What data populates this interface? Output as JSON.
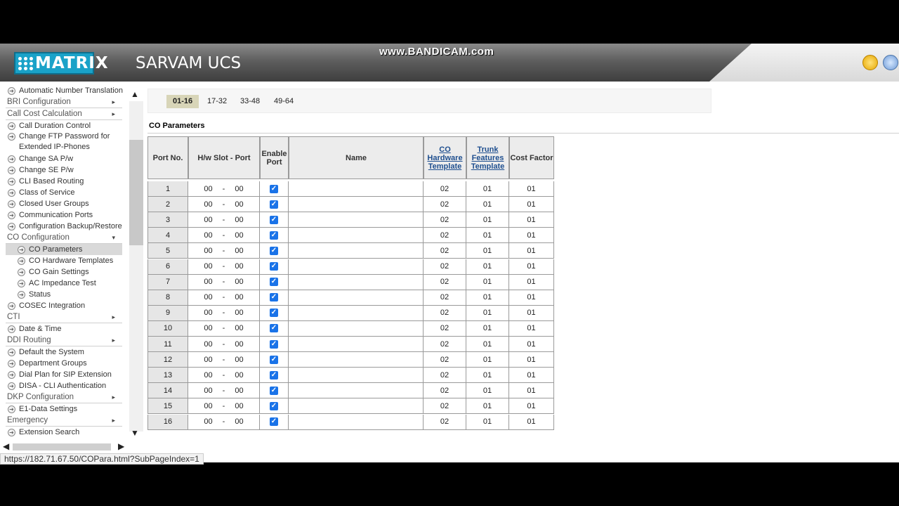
{
  "header": {
    "brand": "MATRIX",
    "app_title": "SARVAM UCS",
    "watermark": "www.BANDICAM.com",
    "icons": [
      "favorites-icon",
      "lock-icon"
    ]
  },
  "sidebar": {
    "items": [
      {
        "label": "Automatic Number Translation",
        "kind": "item"
      },
      {
        "label": "BRI Configuration",
        "kind": "cat",
        "caret": "▸"
      },
      {
        "label": "Call Cost Calculation",
        "kind": "cat",
        "caret": "▸"
      },
      {
        "label": "Call Duration Control",
        "kind": "item"
      },
      {
        "label": "Change FTP Password for Extended IP-Phones",
        "kind": "tall"
      },
      {
        "label": "Change SA P/w",
        "kind": "item"
      },
      {
        "label": "Change SE P/w",
        "kind": "item"
      },
      {
        "label": "CLI Based Routing",
        "kind": "item"
      },
      {
        "label": "Class of Service",
        "kind": "item"
      },
      {
        "label": "Closed User Groups",
        "kind": "item"
      },
      {
        "label": "Communication Ports",
        "kind": "item"
      },
      {
        "label": "Configuration Backup/Restore",
        "kind": "item"
      },
      {
        "label": "CO Configuration",
        "kind": "cat",
        "caret": "▾"
      },
      {
        "label": "CO Parameters",
        "kind": "sub",
        "active": true
      },
      {
        "label": "CO Hardware Templates",
        "kind": "sub"
      },
      {
        "label": "CO Gain Settings",
        "kind": "sub"
      },
      {
        "label": "AC Impedance Test",
        "kind": "sub"
      },
      {
        "label": "Status",
        "kind": "sub"
      },
      {
        "label": "COSEC Integration",
        "kind": "item"
      },
      {
        "label": "CTI",
        "kind": "cat",
        "caret": "▸"
      },
      {
        "label": "Date & Time",
        "kind": "item"
      },
      {
        "label": "DDI Routing",
        "kind": "cat",
        "caret": "▸"
      },
      {
        "label": "Default the System",
        "kind": "item"
      },
      {
        "label": "Department Groups",
        "kind": "item"
      },
      {
        "label": "Dial Plan for SIP Extension",
        "kind": "item"
      },
      {
        "label": "DISA - CLI Authentication",
        "kind": "item"
      },
      {
        "label": "DKP Configuration",
        "kind": "cat",
        "caret": "▸"
      },
      {
        "label": "E1-Data Settings",
        "kind": "item"
      },
      {
        "label": "Emergency",
        "kind": "cat",
        "caret": "▸"
      },
      {
        "label": "Extension Search",
        "kind": "item"
      }
    ]
  },
  "status_url": "https://182.71.67.50/COPara.html?SubPageIndex=1",
  "tabs": [
    {
      "label": "01-16",
      "active": true
    },
    {
      "label": "17-32"
    },
    {
      "label": "33-48"
    },
    {
      "label": "49-64"
    }
  ],
  "section_title": "CO Parameters",
  "table": {
    "headers": [
      "Port No.",
      "H/w Slot - Port",
      "Enable Port",
      "Name",
      "CO Hardware Template",
      "Trunk Features Template",
      "Cost Factor"
    ],
    "rows": [
      {
        "port": "1",
        "slot": "00",
        "slot_port": "00",
        "enabled": true,
        "name": "",
        "co_hw": "02",
        "trunk": "01",
        "cost": "01"
      },
      {
        "port": "2",
        "slot": "00",
        "slot_port": "00",
        "enabled": true,
        "name": "",
        "co_hw": "02",
        "trunk": "01",
        "cost": "01"
      },
      {
        "port": "3",
        "slot": "00",
        "slot_port": "00",
        "enabled": true,
        "name": "",
        "co_hw": "02",
        "trunk": "01",
        "cost": "01"
      },
      {
        "port": "4",
        "slot": "00",
        "slot_port": "00",
        "enabled": true,
        "name": "",
        "co_hw": "02",
        "trunk": "01",
        "cost": "01"
      },
      {
        "port": "5",
        "slot": "00",
        "slot_port": "00",
        "enabled": true,
        "name": "",
        "co_hw": "02",
        "trunk": "01",
        "cost": "01"
      },
      {
        "port": "6",
        "slot": "00",
        "slot_port": "00",
        "enabled": true,
        "name": "",
        "co_hw": "02",
        "trunk": "01",
        "cost": "01"
      },
      {
        "port": "7",
        "slot": "00",
        "slot_port": "00",
        "enabled": true,
        "name": "",
        "co_hw": "02",
        "trunk": "01",
        "cost": "01"
      },
      {
        "port": "8",
        "slot": "00",
        "slot_port": "00",
        "enabled": true,
        "name": "",
        "co_hw": "02",
        "trunk": "01",
        "cost": "01"
      },
      {
        "port": "9",
        "slot": "00",
        "slot_port": "00",
        "enabled": true,
        "name": "",
        "co_hw": "02",
        "trunk": "01",
        "cost": "01"
      },
      {
        "port": "10",
        "slot": "00",
        "slot_port": "00",
        "enabled": true,
        "name": "",
        "co_hw": "02",
        "trunk": "01",
        "cost": "01"
      },
      {
        "port": "11",
        "slot": "00",
        "slot_port": "00",
        "enabled": true,
        "name": "",
        "co_hw": "02",
        "trunk": "01",
        "cost": "01"
      },
      {
        "port": "12",
        "slot": "00",
        "slot_port": "00",
        "enabled": true,
        "name": "",
        "co_hw": "02",
        "trunk": "01",
        "cost": "01"
      },
      {
        "port": "13",
        "slot": "00",
        "slot_port": "00",
        "enabled": true,
        "name": "",
        "co_hw": "02",
        "trunk": "01",
        "cost": "01"
      },
      {
        "port": "14",
        "slot": "00",
        "slot_port": "00",
        "enabled": true,
        "name": "",
        "co_hw": "02",
        "trunk": "01",
        "cost": "01"
      },
      {
        "port": "15",
        "slot": "00",
        "slot_port": "00",
        "enabled": true,
        "name": "",
        "co_hw": "02",
        "trunk": "01",
        "cost": "01"
      },
      {
        "port": "16",
        "slot": "00",
        "slot_port": "00",
        "enabled": true,
        "name": "",
        "co_hw": "02",
        "trunk": "01",
        "cost": "01"
      }
    ]
  },
  "colors": {
    "brand": "#1aa2c8",
    "active_tab": "#d8d5b8",
    "checkbox": "#1a73e8"
  }
}
